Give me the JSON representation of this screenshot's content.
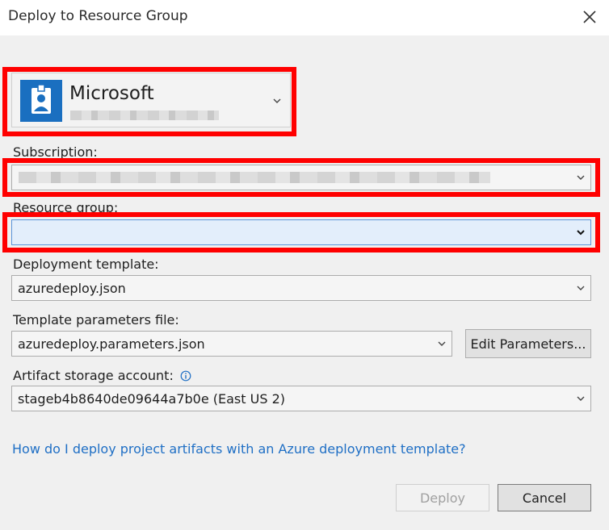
{
  "window": {
    "title": "Deploy to Resource Group"
  },
  "account": {
    "name": "Microsoft"
  },
  "subscription": {
    "label": "Subscription:"
  },
  "resource_group": {
    "label": "Resource group:",
    "value": ""
  },
  "deployment_template": {
    "label": "Deployment template:",
    "value": "azuredeploy.json"
  },
  "template_parameters": {
    "label": "Template parameters file:",
    "value": "azuredeploy.parameters.json",
    "edit_button": "Edit Parameters..."
  },
  "artifact_storage": {
    "label": "Artifact storage account:",
    "value": "stageb4b8640de09644a7b0e (East US 2)"
  },
  "help": {
    "link_text": "How do I deploy project artifacts with an Azure deployment template?"
  },
  "footer": {
    "deploy_label": "Deploy",
    "cancel_label": "Cancel"
  },
  "colors": {
    "accent_highlight": "#ff0000",
    "link": "#1f6fc5",
    "focus_fill": "#e3eefb",
    "focus_border": "#5a94d9"
  },
  "icons": {
    "account_icon": "azure-badge-icon",
    "close_icon": "close-x-icon",
    "info_icon": "info-icon",
    "dropdown_icon": "chevron-down-icon"
  }
}
